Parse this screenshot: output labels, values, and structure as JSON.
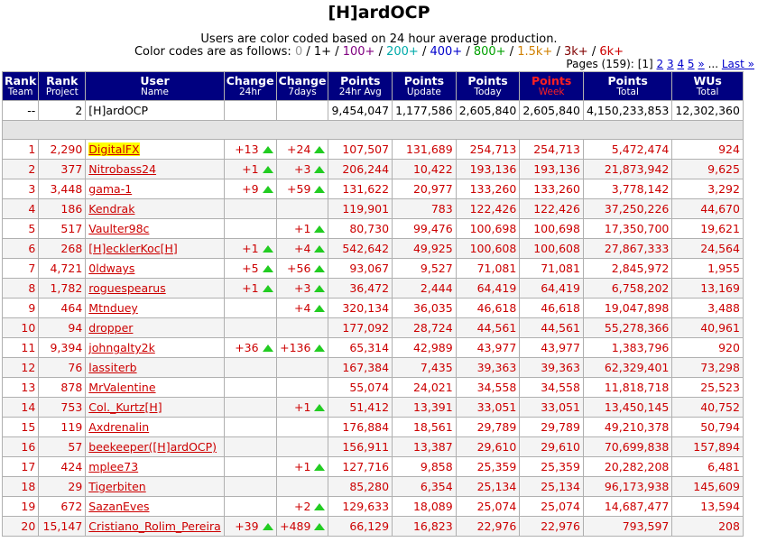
{
  "title": "[H]ardOCP",
  "info_line1": "Users are color coded based on 24 hour average production.",
  "info_line2_prefix": "Color codes are as follows:",
  "color_codes": [
    {
      "label": "0",
      "color": "#999999"
    },
    {
      "label": "1+",
      "color": "#000000"
    },
    {
      "label": "100+",
      "color": "#800080"
    },
    {
      "label": "200+",
      "color": "#00aaaa"
    },
    {
      "label": "400+",
      "color": "#0000cc"
    },
    {
      "label": "800+",
      "color": "#00a000"
    },
    {
      "label": "1.5k+",
      "color": "#d08000"
    },
    {
      "label": "3k+",
      "color": "#800000"
    },
    {
      "label": "6k+",
      "color": "#cc0000"
    }
  ],
  "pages": {
    "label": "Pages (159):",
    "current": "[1]",
    "links": [
      "2",
      "3",
      "4",
      "5",
      "»"
    ],
    "ellipsis": "...",
    "last": "Last »"
  },
  "columns": [
    {
      "title": "Rank",
      "sub": "Team"
    },
    {
      "title": "Rank",
      "sub": "Project"
    },
    {
      "title": "User",
      "sub": "Name"
    },
    {
      "title": "Change",
      "sub": "24hr"
    },
    {
      "title": "Change",
      "sub": "7days"
    },
    {
      "title": "Points",
      "sub": "24hr Avg"
    },
    {
      "title": "Points",
      "sub": "Update"
    },
    {
      "title": "Points",
      "sub": "Today"
    },
    {
      "title": "Points",
      "sub": "Week"
    },
    {
      "title": "Points",
      "sub": "Total"
    },
    {
      "title": "WUs",
      "sub": "Total"
    }
  ],
  "team_row": {
    "rank": "--",
    "project_rank": "2",
    "name": "[H]ardOCP",
    "c24": "",
    "c7": "",
    "avg24": "9,454,047",
    "update": "1,177,586",
    "today": "2,605,840",
    "week": "2,605,840",
    "total": "4,150,233,853",
    "wus": "12,302,360"
  },
  "rows": [
    {
      "rank": "1",
      "proj": "2,290",
      "name": "DigitalFX",
      "c24": "+13",
      "c7": "+24",
      "avg": "107,507",
      "upd": "131,689",
      "today": "254,713",
      "week": "254,713",
      "total": "5,472,474",
      "wus": "924"
    },
    {
      "rank": "2",
      "proj": "377",
      "name": "Nitrobass24",
      "c24": "+1",
      "c7": "+3",
      "avg": "206,244",
      "upd": "10,422",
      "today": "193,136",
      "week": "193,136",
      "total": "21,873,942",
      "wus": "9,625"
    },
    {
      "rank": "3",
      "proj": "3,448",
      "name": "gama-1",
      "c24": "+9",
      "c7": "+59",
      "avg": "131,622",
      "upd": "20,977",
      "today": "133,260",
      "week": "133,260",
      "total": "3,778,142",
      "wus": "3,292"
    },
    {
      "rank": "4",
      "proj": "186",
      "name": "Kendrak",
      "c24": "",
      "c7": "",
      "avg": "119,901",
      "upd": "783",
      "today": "122,426",
      "week": "122,426",
      "total": "37,250,226",
      "wus": "44,670"
    },
    {
      "rank": "5",
      "proj": "517",
      "name": "Vaulter98c",
      "c24": "",
      "c7": "+1",
      "avg": "80,730",
      "upd": "99,476",
      "today": "100,698",
      "week": "100,698",
      "total": "17,350,700",
      "wus": "19,621"
    },
    {
      "rank": "6",
      "proj": "268",
      "name": "[H]ecklerKoc[H]",
      "c24": "+1",
      "c7": "+4",
      "avg": "542,642",
      "upd": "49,925",
      "today": "100,608",
      "week": "100,608",
      "total": "27,867,333",
      "wus": "24,564"
    },
    {
      "rank": "7",
      "proj": "4,721",
      "name": "0ldways",
      "c24": "+5",
      "c7": "+56",
      "avg": "93,067",
      "upd": "9,527",
      "today": "71,081",
      "week": "71,081",
      "total": "2,845,972",
      "wus": "1,955"
    },
    {
      "rank": "8",
      "proj": "1,782",
      "name": "roguespearus",
      "c24": "+1",
      "c7": "+3",
      "avg": "36,472",
      "upd": "2,444",
      "today": "64,419",
      "week": "64,419",
      "total": "6,758,202",
      "wus": "13,169"
    },
    {
      "rank": "9",
      "proj": "464",
      "name": "Mtnduey",
      "c24": "",
      "c7": "+4",
      "avg": "320,134",
      "upd": "36,035",
      "today": "46,618",
      "week": "46,618",
      "total": "19,047,898",
      "wus": "3,488"
    },
    {
      "rank": "10",
      "proj": "94",
      "name": "dropper",
      "c24": "",
      "c7": "",
      "avg": "177,092",
      "upd": "28,724",
      "today": "44,561",
      "week": "44,561",
      "total": "55,278,366",
      "wus": "40,961"
    },
    {
      "rank": "11",
      "proj": "9,394",
      "name": "johngalty2k",
      "c24": "+36",
      "c7": "+136",
      "avg": "65,314",
      "upd": "42,989",
      "today": "43,977",
      "week": "43,977",
      "total": "1,383,796",
      "wus": "920"
    },
    {
      "rank": "12",
      "proj": "76",
      "name": "lassiterb",
      "c24": "",
      "c7": "",
      "avg": "167,384",
      "upd": "7,435",
      "today": "39,363",
      "week": "39,363",
      "total": "62,329,401",
      "wus": "73,298"
    },
    {
      "rank": "13",
      "proj": "878",
      "name": "MrValentine",
      "c24": "",
      "c7": "",
      "avg": "55,074",
      "upd": "24,021",
      "today": "34,558",
      "week": "34,558",
      "total": "11,818,718",
      "wus": "25,523"
    },
    {
      "rank": "14",
      "proj": "753",
      "name": "Col._Kurtz[H]",
      "c24": "",
      "c7": "+1",
      "avg": "51,412",
      "upd": "13,391",
      "today": "33,051",
      "week": "33,051",
      "total": "13,450,145",
      "wus": "40,752"
    },
    {
      "rank": "15",
      "proj": "119",
      "name": "Axdrenalin",
      "c24": "",
      "c7": "",
      "avg": "176,884",
      "upd": "18,561",
      "today": "29,789",
      "week": "29,789",
      "total": "49,210,378",
      "wus": "50,794"
    },
    {
      "rank": "16",
      "proj": "57",
      "name": "beekeeper([H]ardOCP)",
      "c24": "",
      "c7": "",
      "avg": "156,911",
      "upd": "13,387",
      "today": "29,610",
      "week": "29,610",
      "total": "70,699,838",
      "wus": "157,894"
    },
    {
      "rank": "17",
      "proj": "424",
      "name": "mplee73",
      "c24": "",
      "c7": "+1",
      "avg": "127,716",
      "upd": "9,858",
      "today": "25,359",
      "week": "25,359",
      "total": "20,282,208",
      "wus": "6,481"
    },
    {
      "rank": "18",
      "proj": "29",
      "name": "Tigerbiten",
      "c24": "",
      "c7": "",
      "avg": "85,280",
      "upd": "6,354",
      "today": "25,134",
      "week": "25,134",
      "total": "96,173,938",
      "wus": "145,609"
    },
    {
      "rank": "19",
      "proj": "672",
      "name": "SazanEves",
      "c24": "",
      "c7": "+2",
      "avg": "129,633",
      "upd": "18,089",
      "today": "25,074",
      "week": "25,074",
      "total": "14,687,477",
      "wus": "13,594"
    },
    {
      "rank": "20",
      "proj": "15,147",
      "name": "Cristiano_Rolim_Pereira",
      "c24": "+39",
      "c7": "+489",
      "avg": "66,129",
      "upd": "16,823",
      "today": "22,976",
      "week": "22,976",
      "total": "793,597",
      "wus": "208"
    }
  ]
}
